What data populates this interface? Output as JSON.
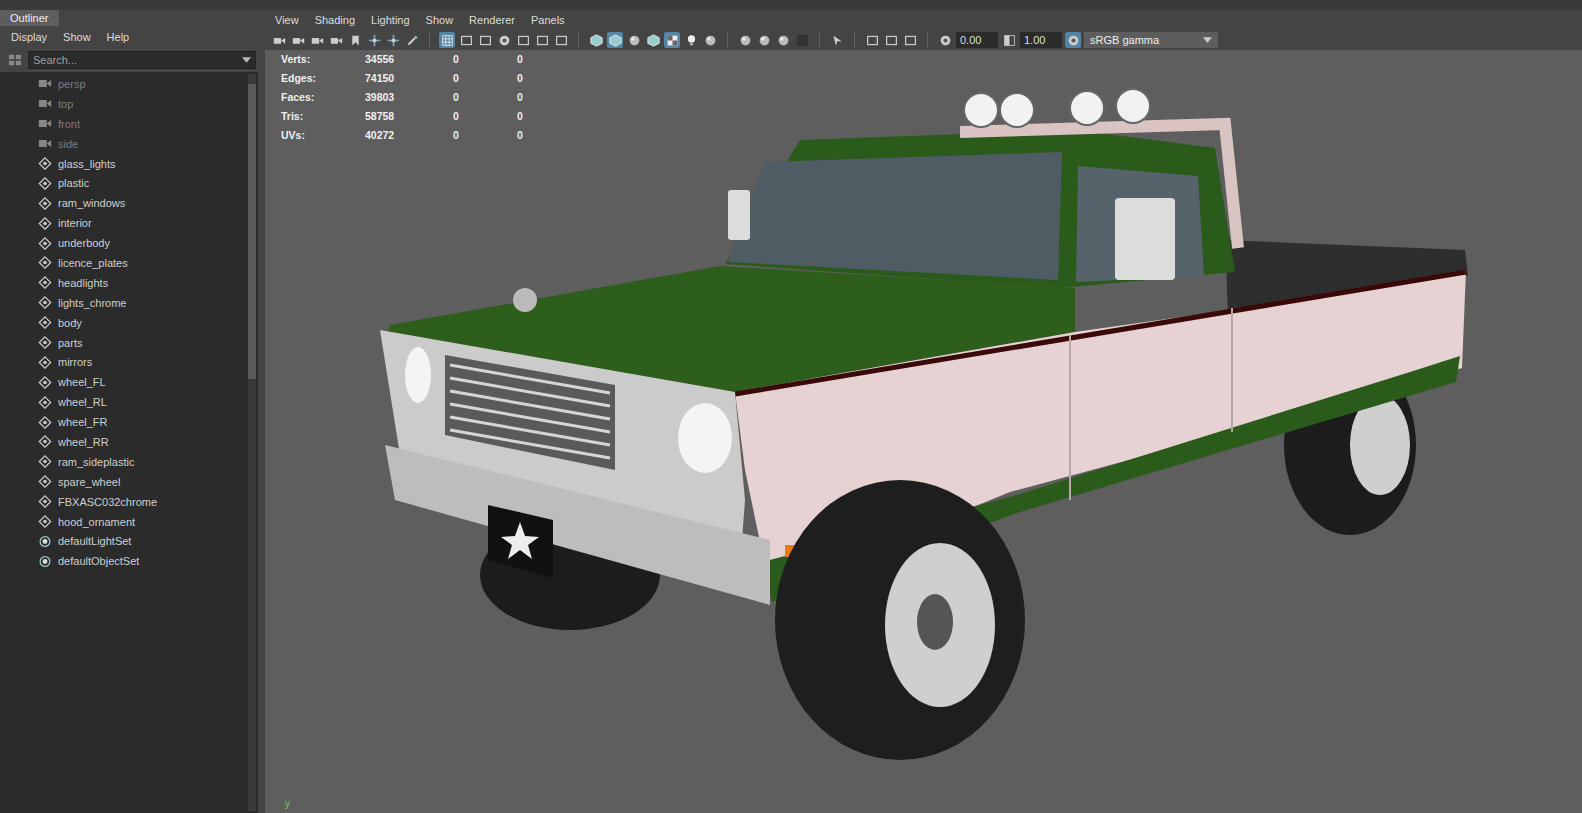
{
  "outliner": {
    "tab": {
      "label": "Outliner",
      "selected": true
    },
    "menu": [
      "Display",
      "Show",
      "Help"
    ],
    "search": {
      "placeholder": "Search..."
    },
    "items": [
      {
        "name": "persp",
        "kind": "camera",
        "dimmed": true
      },
      {
        "name": "top",
        "kind": "camera",
        "dimmed": true
      },
      {
        "name": "front",
        "kind": "camera",
        "dimmed": true
      },
      {
        "name": "side",
        "kind": "camera",
        "dimmed": true
      },
      {
        "name": "glass_lights",
        "kind": "transform",
        "dimmed": false
      },
      {
        "name": "plastic",
        "kind": "transform",
        "dimmed": false
      },
      {
        "name": "ram_windows",
        "kind": "transform",
        "dimmed": false
      },
      {
        "name": "interior",
        "kind": "transform",
        "dimmed": false
      },
      {
        "name": "underbody",
        "kind": "transform",
        "dimmed": false
      },
      {
        "name": "licence_plates",
        "kind": "transform",
        "dimmed": false
      },
      {
        "name": "headlights",
        "kind": "transform",
        "dimmed": false
      },
      {
        "name": "lights_chrome",
        "kind": "transform",
        "dimmed": false
      },
      {
        "name": "body",
        "kind": "transform",
        "dimmed": false
      },
      {
        "name": "parts",
        "kind": "transform",
        "dimmed": false
      },
      {
        "name": "mirrors",
        "kind": "transform",
        "dimmed": false
      },
      {
        "name": "wheel_FL",
        "kind": "transform",
        "dimmed": false
      },
      {
        "name": "wheel_RL",
        "kind": "transform",
        "dimmed": false
      },
      {
        "name": "wheel_FR",
        "kind": "transform",
        "dimmed": false
      },
      {
        "name": "wheel_RR",
        "kind": "transform",
        "dimmed": false
      },
      {
        "name": "ram_sideplastic",
        "kind": "transform",
        "dimmed": false
      },
      {
        "name": "spare_wheel",
        "kind": "transform",
        "dimmed": false
      },
      {
        "name": "FBXASC032chrome",
        "kind": "transform",
        "dimmed": false
      },
      {
        "name": "hood_ornament",
        "kind": "transform",
        "dimmed": false
      },
      {
        "name": "defaultLightSet",
        "kind": "set",
        "dimmed": false
      },
      {
        "name": "defaultObjectSet",
        "kind": "set",
        "dimmed": false
      }
    ]
  },
  "viewport": {
    "menu": [
      "View",
      "Shading",
      "Lighting",
      "Show",
      "Renderer",
      "Panels"
    ],
    "toolbar": [
      {
        "kind": "icon",
        "icon": "camera",
        "selected": false
      },
      {
        "kind": "icon",
        "icon": "camera",
        "selected": false
      },
      {
        "kind": "icon",
        "icon": "camera",
        "selected": false
      },
      {
        "kind": "icon",
        "icon": "camera",
        "selected": false
      },
      {
        "kind": "icon",
        "icon": "bookmark",
        "selected": false
      },
      {
        "kind": "icon",
        "icon": "move",
        "selected": false
      },
      {
        "kind": "icon",
        "icon": "move",
        "selected": false
      },
      {
        "kind": "icon",
        "icon": "pencil",
        "selected": false
      },
      {
        "kind": "separator"
      },
      {
        "kind": "icon",
        "icon": "grid",
        "selected": true
      },
      {
        "kind": "icon",
        "icon": "frame",
        "selected": false
      },
      {
        "kind": "icon",
        "icon": "frame",
        "selected": false
      },
      {
        "kind": "icon",
        "icon": "disc",
        "selected": false
      },
      {
        "kind": "icon",
        "icon": "frame",
        "selected": false
      },
      {
        "kind": "icon",
        "icon": "frame",
        "selected": false
      },
      {
        "kind": "icon",
        "icon": "frame",
        "selected": false
      },
      {
        "kind": "separator"
      },
      {
        "kind": "icon",
        "icon": "cube",
        "selected": false
      },
      {
        "kind": "icon",
        "icon": "cube",
        "selected": true
      },
      {
        "kind": "icon",
        "icon": "sphere",
        "selected": false
      },
      {
        "kind": "icon",
        "icon": "cube",
        "selected": false
      },
      {
        "kind": "icon",
        "icon": "checker",
        "selected": true
      },
      {
        "kind": "icon",
        "icon": "bulb",
        "selected": false
      },
      {
        "kind": "icon",
        "icon": "sphere",
        "selected": false
      },
      {
        "kind": "separator"
      },
      {
        "kind": "icon",
        "icon": "sphere",
        "selected": false
      },
      {
        "kind": "icon",
        "icon": "sphere",
        "selected": false
      },
      {
        "kind": "icon",
        "icon": "sphere",
        "selected": false
      },
      {
        "kind": "icon",
        "icon": "dark",
        "selected": false
      },
      {
        "kind": "separator"
      },
      {
        "kind": "icon",
        "icon": "cursor",
        "selected": false
      },
      {
        "kind": "separator"
      },
      {
        "kind": "icon",
        "icon": "frame",
        "selected": false
      },
      {
        "kind": "icon",
        "icon": "frame",
        "selected": false
      },
      {
        "kind": "icon",
        "icon": "frame",
        "selected": false
      },
      {
        "kind": "separator"
      },
      {
        "kind": "icon",
        "icon": "disc",
        "selected": false
      },
      {
        "kind": "field",
        "text": "0.00"
      },
      {
        "kind": "icon",
        "icon": "half",
        "selected": false
      },
      {
        "kind": "field",
        "text": "1.00"
      },
      {
        "kind": "icon",
        "icon": "disc",
        "selected": true
      },
      {
        "kind": "dropdown",
        "text": "sRGB gamma"
      }
    ],
    "stats": [
      {
        "label": "Verts:",
        "values": [
          "34556",
          "0",
          "0"
        ]
      },
      {
        "label": "Edges:",
        "values": [
          "74150",
          "0",
          "0"
        ]
      },
      {
        "label": "Faces:",
        "values": [
          "39803",
          "0",
          "0"
        ]
      },
      {
        "label": "Tris:",
        "values": [
          "58758",
          "0",
          "0"
        ]
      },
      {
        "label": "UVs:",
        "values": [
          "40272",
          "0",
          "0"
        ]
      }
    ],
    "axis": "y"
  }
}
